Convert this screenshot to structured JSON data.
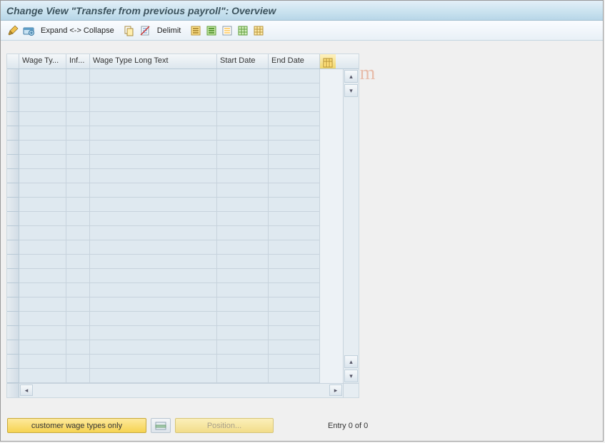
{
  "title": "Change View \"Transfer from previous payroll\": Overview",
  "toolbar": {
    "expand_collapse": "Expand <-> Collapse",
    "delimit": "Delimit"
  },
  "table": {
    "columns": {
      "c1": "Wage Ty...",
      "c2": "Inf...",
      "c3": "Wage Type Long Text",
      "c4": "Start Date",
      "c5": "End Date"
    },
    "row_count": 22
  },
  "footer": {
    "customer_btn": "customer wage types only",
    "position_btn": "Position...",
    "entry_text": "Entry 0 of 0"
  },
  "watermark": "www.tutorialkart.com"
}
